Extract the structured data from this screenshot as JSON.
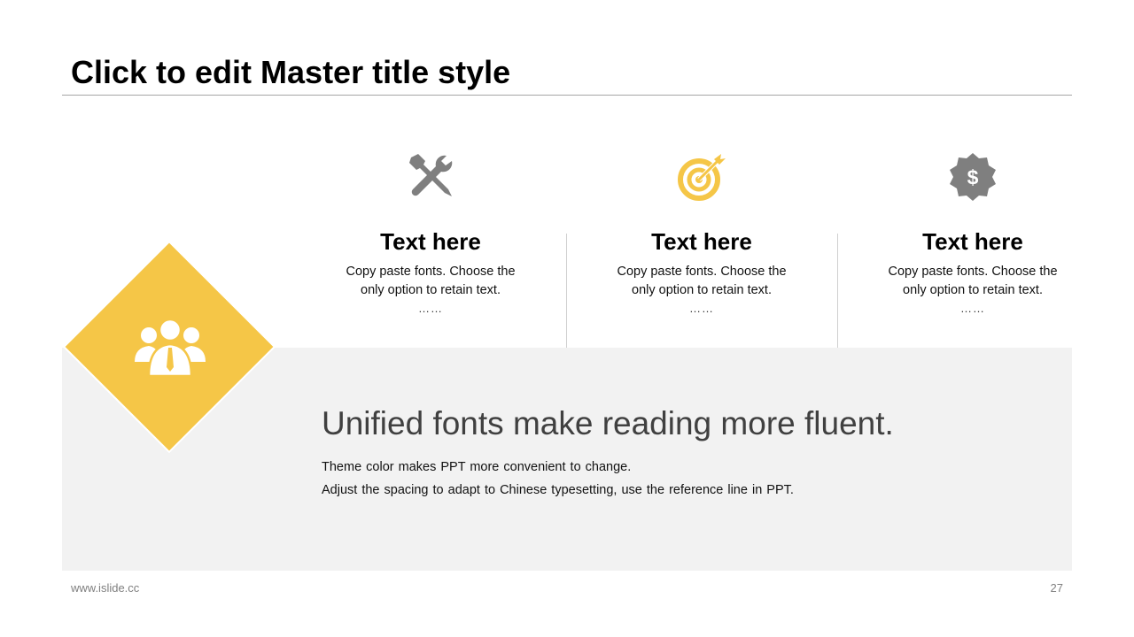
{
  "slide": {
    "title": "Click to edit Master title style",
    "columns": [
      {
        "icon": "tools-icon",
        "heading": "Text here",
        "desc": "Copy paste fonts. Choose the only option to retain text.",
        "ellipsis": "……"
      },
      {
        "icon": "target-icon",
        "heading": "Text here",
        "desc": "Copy paste fonts. Choose the only option to retain text.",
        "ellipsis": "……"
      },
      {
        "icon": "dollar-badge-icon",
        "heading": "Text here",
        "desc": "Copy paste fonts. Choose the only option to retain text.",
        "ellipsis": "……"
      }
    ],
    "feature": {
      "icon": "team-icon",
      "headline": "Unified fonts make reading more fluent.",
      "line1": "Theme color makes PPT more convenient to change.",
      "line2": "Adjust the spacing to adapt to Chinese typesetting, use the reference line in PPT."
    }
  },
  "footer": {
    "website": "www.islide.cc",
    "page_number": "27"
  },
  "colors": {
    "accent": "#f5c647",
    "icon_gray": "#7f7f7f",
    "panel": "#f2f2f2",
    "rule": "#a6a6a6",
    "divider": "#d0d0d0"
  }
}
